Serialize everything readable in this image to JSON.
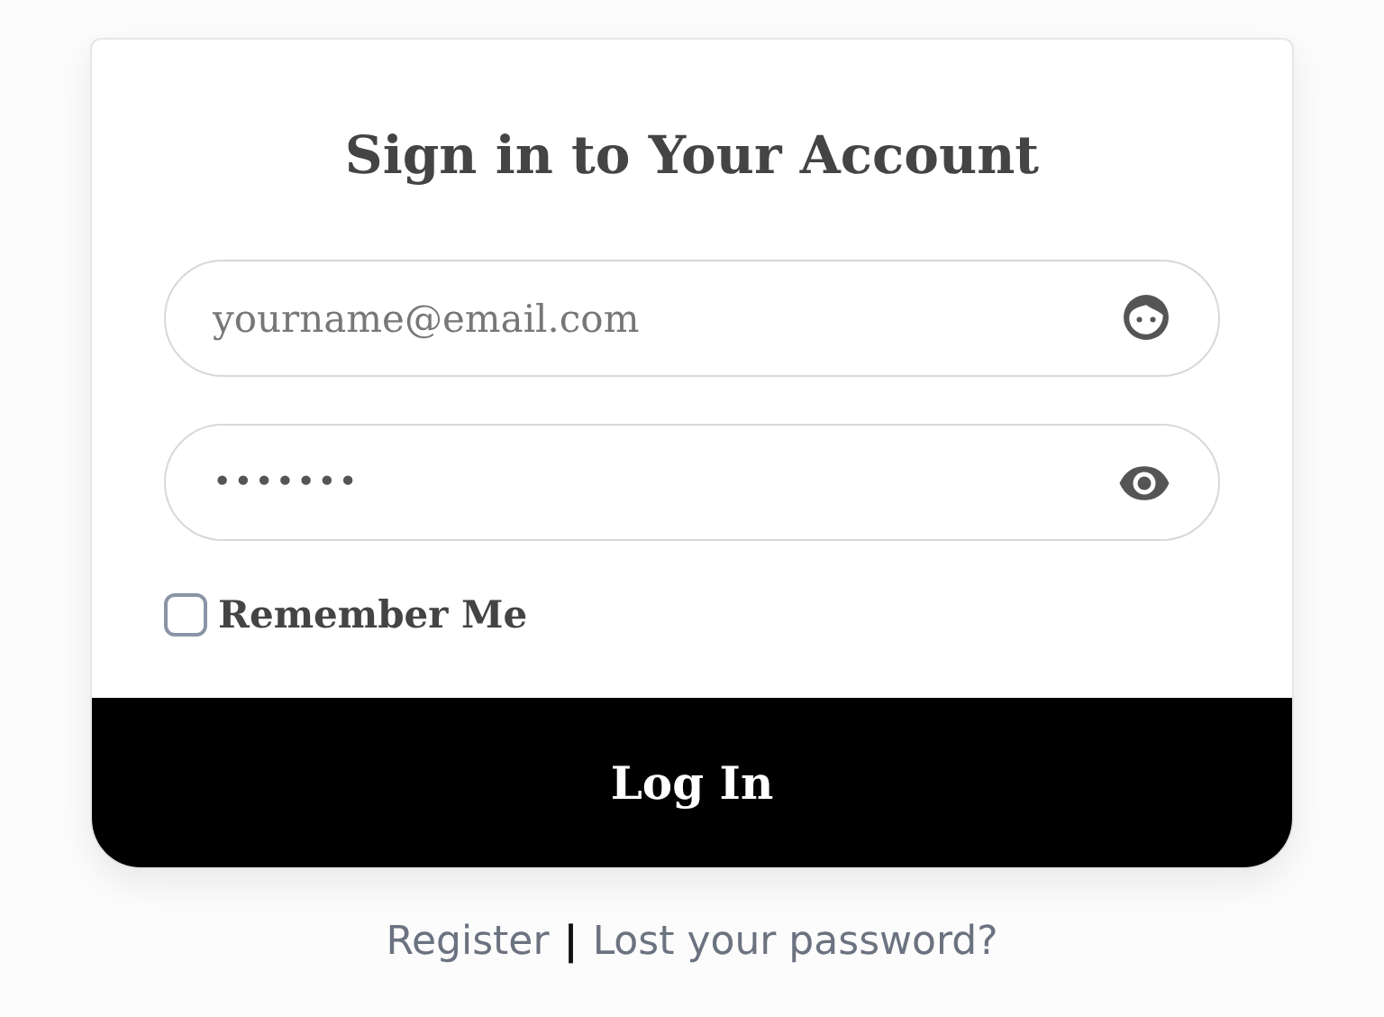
{
  "title": "Sign in to Your Account",
  "fields": [
    {
      "kind": "email",
      "placeholder": "yourname@email.com"
    },
    {
      "kind": "password",
      "value": "•••••••"
    }
  ],
  "remember": {
    "label": "Remember Me",
    "checked": false
  },
  "submit": "Log In",
  "links": [
    {
      "kind": "link",
      "text": "Register"
    },
    {
      "kind": "separator",
      "text": "|"
    },
    {
      "kind": "link",
      "text": "Lost your password?"
    }
  ]
}
